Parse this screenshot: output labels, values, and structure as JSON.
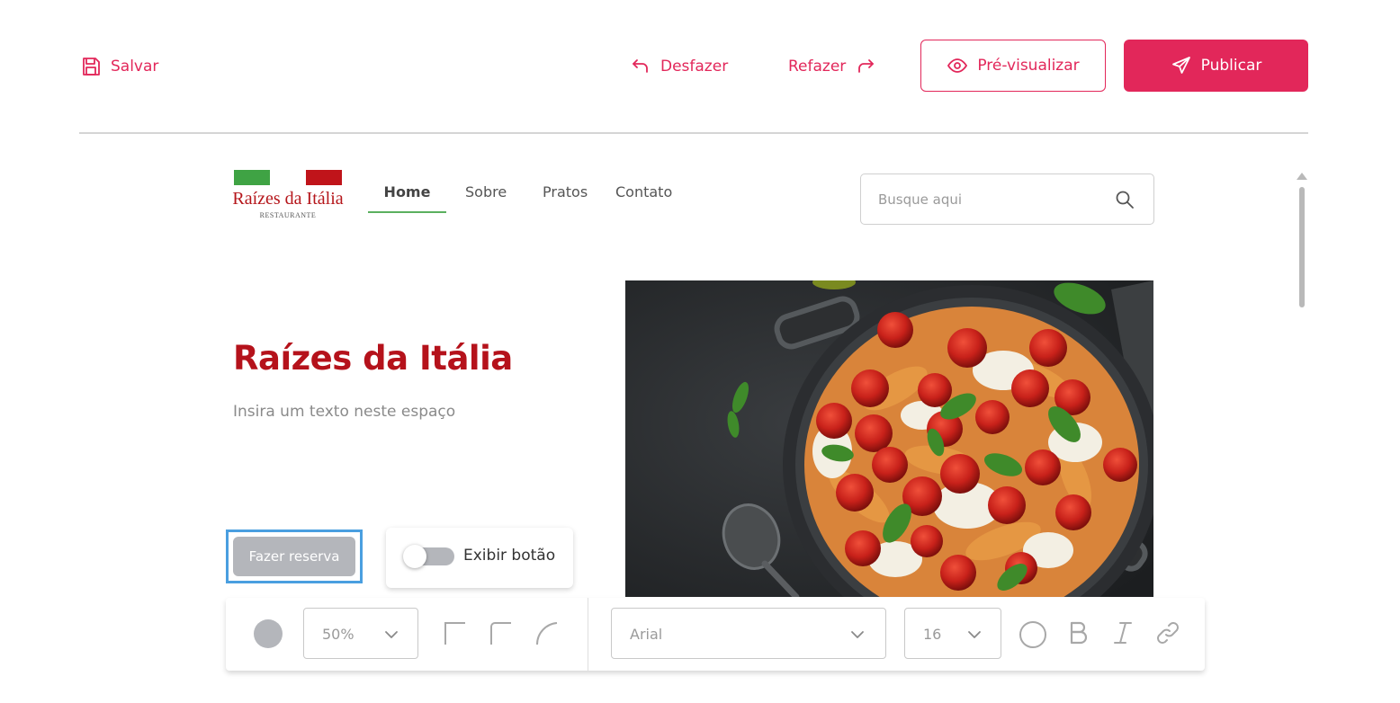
{
  "toolbar": {
    "save_label": "Salvar",
    "undo_label": "Desfazer",
    "redo_label": "Refazer",
    "preview_label": "Pré-visualizar",
    "publish_label": "Publicar",
    "accent_color": "#e2275a"
  },
  "site": {
    "logo": {
      "name": "Raízes da Itália",
      "subtitle": "RESTAURANTE",
      "flag_colors": [
        "#3fa344",
        "#c0141a"
      ]
    },
    "nav": [
      {
        "label": "Home",
        "active": true
      },
      {
        "label": "Sobre",
        "active": false
      },
      {
        "label": "Pratos",
        "active": false
      },
      {
        "label": "Contato",
        "active": false
      }
    ],
    "search": {
      "placeholder": "Busque aqui",
      "icon": "search-icon"
    },
    "hero": {
      "title": "Raízes da Itália",
      "text": "Insira um texto neste espaço",
      "title_color": "#b5121b",
      "image": "pasta-skillet-photo"
    },
    "reserve_button_label": "Fazer reserva",
    "toggle": {
      "label": "Exibir botão",
      "on": false
    }
  },
  "format_bar": {
    "fill_color": "#b4b6bb",
    "opacity": "50%",
    "corner_icons": [
      "square-corner-icon",
      "rounded-corner-icon",
      "round-corner-icon"
    ],
    "font": "Arial",
    "font_size": "16",
    "text_icons": [
      "text-color-icon",
      "bold-icon",
      "italic-icon",
      "link-icon"
    ]
  }
}
